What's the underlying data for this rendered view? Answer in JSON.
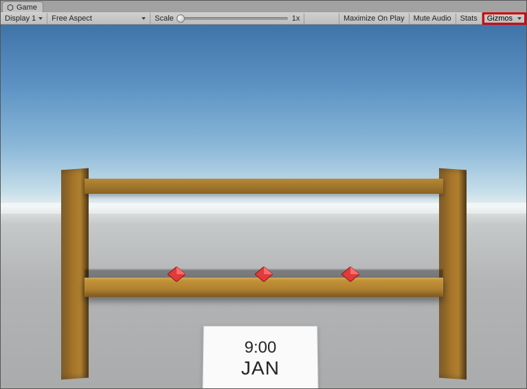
{
  "tab": {
    "label": "Game"
  },
  "toolbar": {
    "display": "Display 1",
    "aspect": "Free Aspect",
    "scale_label": "Scale",
    "scale_value": "1x",
    "maximize": "Maximize On Play",
    "mute": "Mute Audio",
    "stats": "Stats",
    "gizmos": "Gizmos"
  },
  "scene": {
    "card_time": "9:00",
    "card_month": "JAN"
  }
}
